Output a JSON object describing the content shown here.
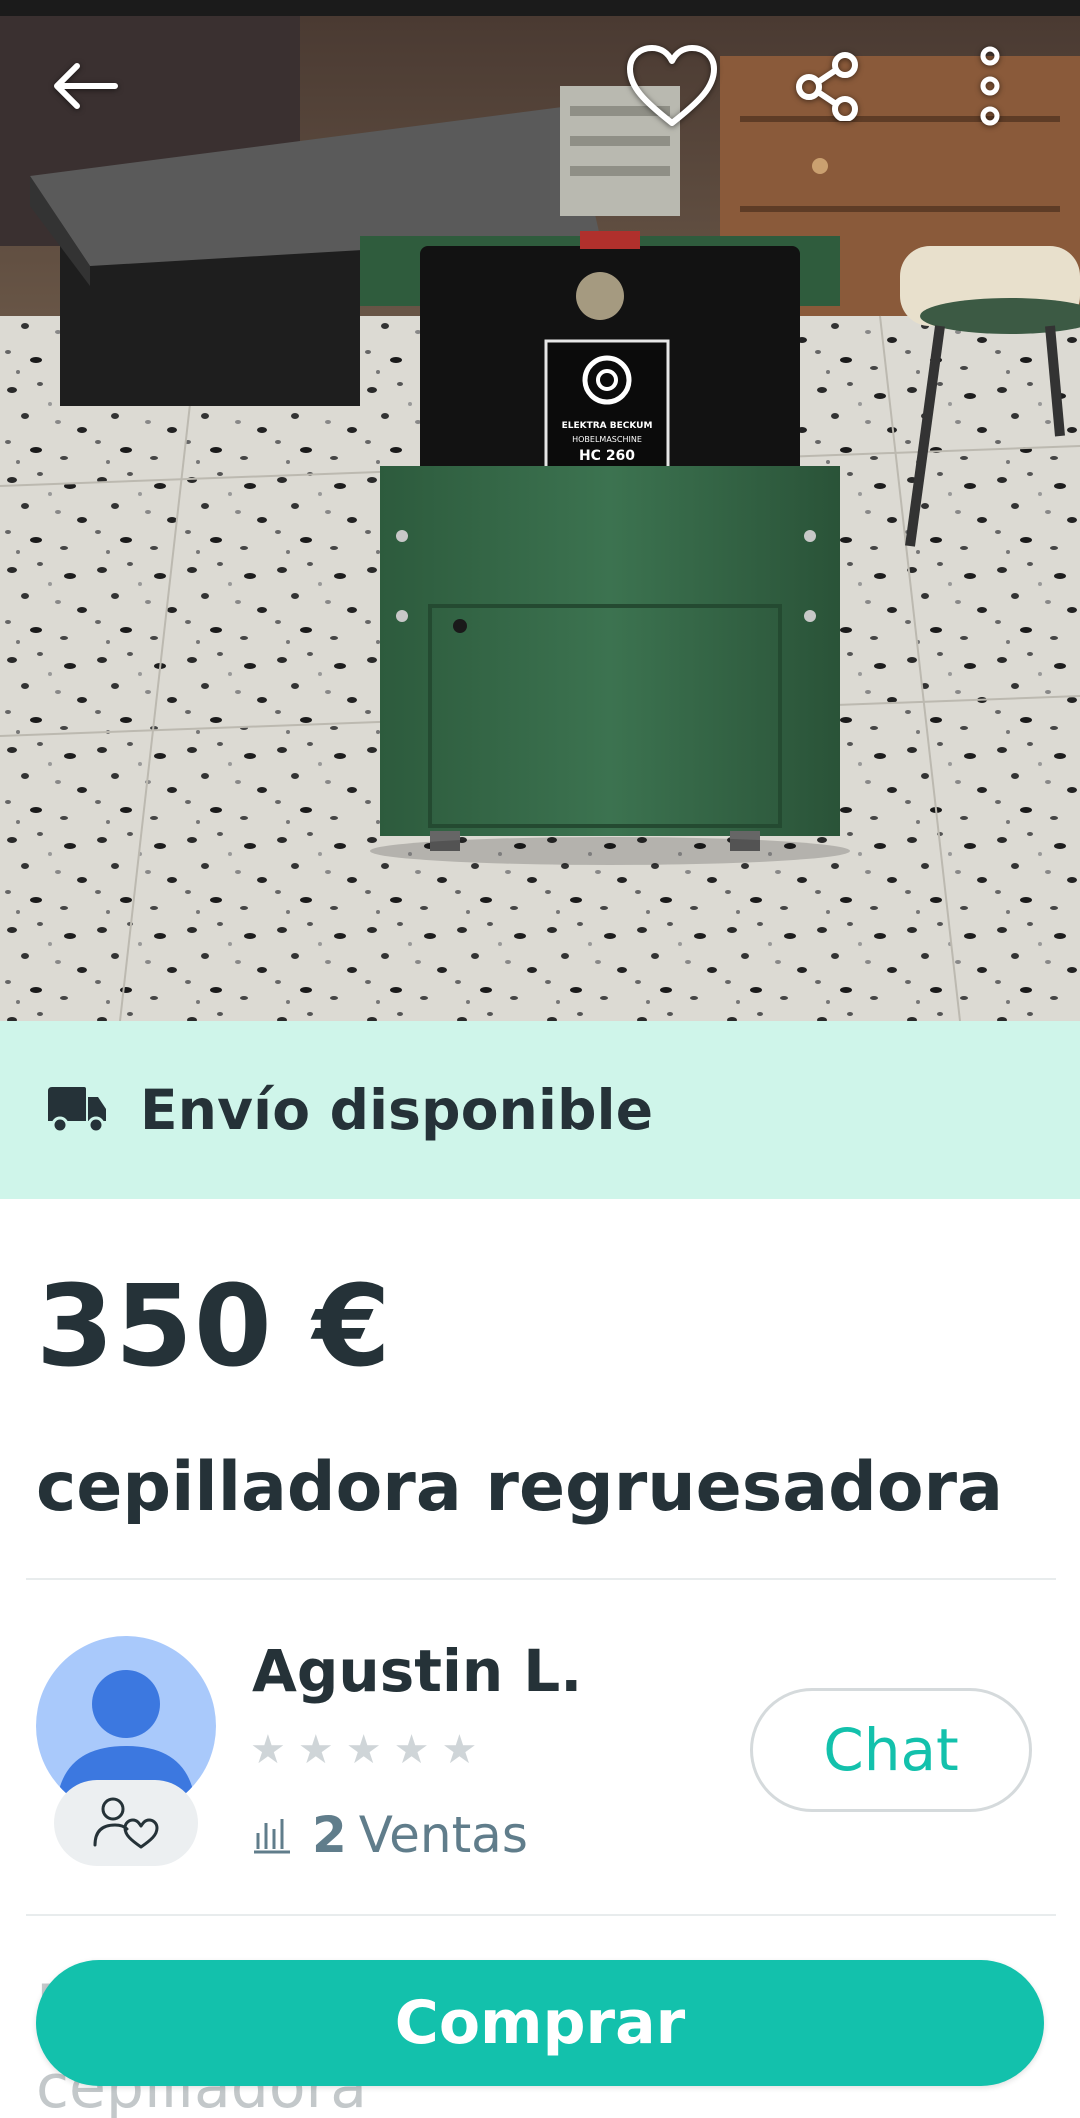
{
  "header": {
    "back_icon": "arrow-left-icon",
    "favorite_icon": "heart-icon",
    "share_icon": "share-icon",
    "more_icon": "more-vertical-icon"
  },
  "product_image": {
    "brand_plate_line1": "ELEKTRA BECKUM",
    "brand_plate_line2": "HOBELMASCHINE",
    "brand_plate_line3": "HC 260"
  },
  "shipping": {
    "icon": "truck-icon",
    "label": "Envío disponible",
    "background": "#cff5ea"
  },
  "product": {
    "price": "350 €",
    "title": "cepilladora regruesadora"
  },
  "seller": {
    "name": "Agustin L.",
    "rating_stars": 0,
    "stars_total": 5,
    "sales_icon": "bar-chart-icon",
    "sales_count": "2",
    "sales_label": "Ventas",
    "badge_icon": "user-heart-icon",
    "chat_label": "Chat"
  },
  "description_peek": {
    "line1": "D",
    "line2": "cepilladora"
  },
  "actions": {
    "buy_label": "Comprar"
  },
  "colors": {
    "accent": "#13c1ac",
    "text": "#253238",
    "muted": "#607d8b"
  }
}
